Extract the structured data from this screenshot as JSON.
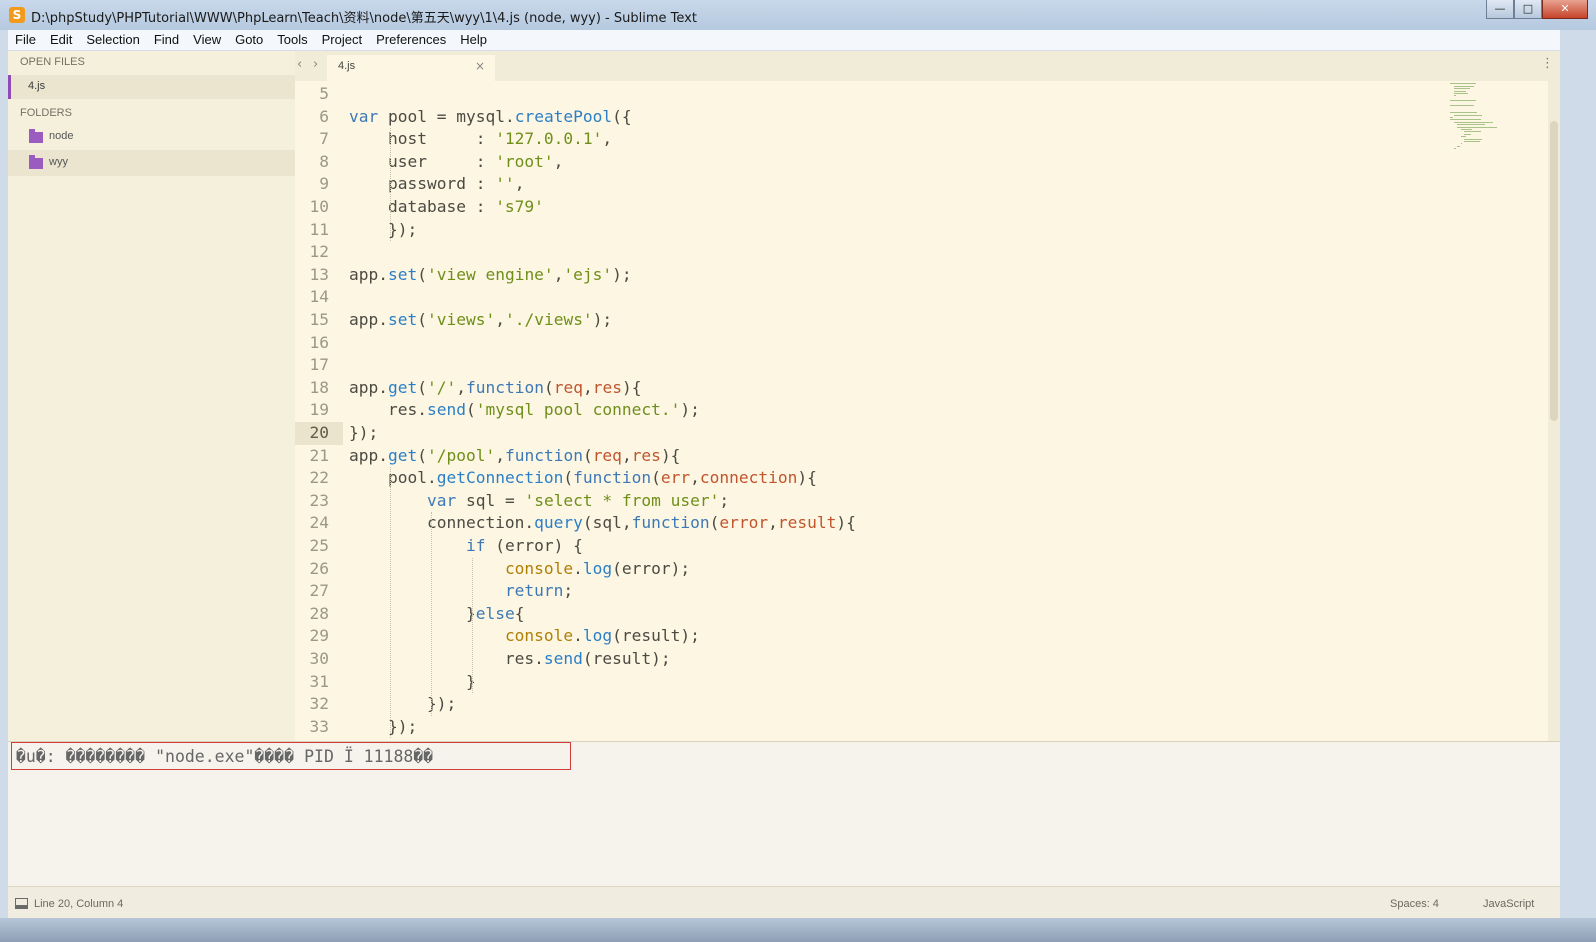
{
  "window": {
    "title": "D:\\phpStudy\\PHPTutorial\\WWW\\PhpLearn\\Teach\\资料\\node\\第五天\\wyy\\1\\4.js (node, wyy) - Sublime Text",
    "app_icon_glyph": "S",
    "minimize_glyph": "—",
    "maximize_glyph": "□",
    "close_glyph": "✕"
  },
  "menu": [
    "File",
    "Edit",
    "Selection",
    "Find",
    "View",
    "Goto",
    "Tools",
    "Project",
    "Preferences",
    "Help"
  ],
  "sidebar": {
    "open_files_heading": "OPEN FILES",
    "open_files": [
      "4.js"
    ],
    "folders_heading": "FOLDERS",
    "folders": [
      {
        "label": "node",
        "selected": false
      },
      {
        "label": "wyy",
        "selected": true
      }
    ]
  },
  "tabs": {
    "back_glyph": "‹",
    "forward_glyph": "›",
    "active_tab": "4.js",
    "close_glyph": "×",
    "overflow_glyph": "⋮"
  },
  "editor": {
    "current_line": "20",
    "line_numbers": [
      "5",
      "6",
      "7",
      "8",
      "9",
      "10",
      "11",
      "12",
      "13",
      "14",
      "15",
      "16",
      "17",
      "18",
      "19",
      "20",
      "21",
      "22",
      "23",
      "24",
      "25",
      "26",
      "27",
      "28",
      "29",
      "30",
      "31",
      "32",
      "33"
    ],
    "code": [
      [],
      [
        [
          "kw",
          "var"
        ],
        [
          "pl",
          " pool = mysql."
        ],
        [
          "fn",
          "createPool"
        ],
        [
          "pl",
          "({"
        ]
      ],
      [
        [
          "pl",
          "    host     : "
        ],
        [
          "str",
          "'127.0.0.1'"
        ],
        [
          "pl",
          ","
        ]
      ],
      [
        [
          "pl",
          "    user     : "
        ],
        [
          "str",
          "'root'"
        ],
        [
          "pl",
          ","
        ]
      ],
      [
        [
          "pl",
          "    password : "
        ],
        [
          "str",
          "''"
        ],
        [
          "pl",
          ","
        ]
      ],
      [
        [
          "pl",
          "    database : "
        ],
        [
          "str",
          "'s79'"
        ]
      ],
      [
        [
          "pl",
          "    });"
        ]
      ],
      [],
      [
        [
          "pl",
          "app."
        ],
        [
          "fn",
          "set"
        ],
        [
          "pl",
          "("
        ],
        [
          "str",
          "'view engine'"
        ],
        [
          "pl",
          ","
        ],
        [
          "str",
          "'ejs'"
        ],
        [
          "pl",
          ");"
        ]
      ],
      [],
      [
        [
          "pl",
          "app."
        ],
        [
          "fn",
          "set"
        ],
        [
          "pl",
          "("
        ],
        [
          "str",
          "'views'"
        ],
        [
          "pl",
          ","
        ],
        [
          "str",
          "'./views'"
        ],
        [
          "pl",
          ");"
        ]
      ],
      [],
      [],
      [
        [
          "pl",
          "app."
        ],
        [
          "fn",
          "get"
        ],
        [
          "pl",
          "("
        ],
        [
          "str",
          "'/'"
        ],
        [
          "pl",
          ","
        ],
        [
          "kw",
          "function"
        ],
        [
          "pl",
          "("
        ],
        [
          "prm",
          "req"
        ],
        [
          "pl",
          ","
        ],
        [
          "prm",
          "res"
        ],
        [
          "pl",
          "){"
        ]
      ],
      [
        [
          "pl",
          "    res."
        ],
        [
          "fn",
          "send"
        ],
        [
          "pl",
          "("
        ],
        [
          "str",
          "'mysql pool connect.'"
        ],
        [
          "pl",
          ");"
        ]
      ],
      [
        [
          "pl",
          "});"
        ]
      ],
      [
        [
          "pl",
          "app."
        ],
        [
          "fn",
          "get"
        ],
        [
          "pl",
          "("
        ],
        [
          "str",
          "'/pool'"
        ],
        [
          "pl",
          ","
        ],
        [
          "kw",
          "function"
        ],
        [
          "pl",
          "("
        ],
        [
          "prm",
          "req"
        ],
        [
          "pl",
          ","
        ],
        [
          "prm",
          "res"
        ],
        [
          "pl",
          "){"
        ]
      ],
      [
        [
          "pl",
          "    pool."
        ],
        [
          "fn",
          "getConnection"
        ],
        [
          "pl",
          "("
        ],
        [
          "kw",
          "function"
        ],
        [
          "pl",
          "("
        ],
        [
          "prm",
          "err"
        ],
        [
          "pl",
          ","
        ],
        [
          "prm",
          "connection"
        ],
        [
          "pl",
          "){"
        ]
      ],
      [
        [
          "pl",
          "        "
        ],
        [
          "kw",
          "var"
        ],
        [
          "pl",
          " sql = "
        ],
        [
          "str",
          "'select * from user'"
        ],
        [
          "pl",
          ";"
        ]
      ],
      [
        [
          "pl",
          "        connection."
        ],
        [
          "fn",
          "query"
        ],
        [
          "pl",
          "(sql,"
        ],
        [
          "kw",
          "function"
        ],
        [
          "pl",
          "("
        ],
        [
          "prm",
          "error"
        ],
        [
          "pl",
          ","
        ],
        [
          "prm",
          "result"
        ],
        [
          "pl",
          "){"
        ]
      ],
      [
        [
          "pl",
          "            "
        ],
        [
          "kw",
          "if"
        ],
        [
          "pl",
          " (error) {"
        ]
      ],
      [
        [
          "pl",
          "                "
        ],
        [
          "con",
          "console"
        ],
        [
          "pl",
          "."
        ],
        [
          "fn",
          "log"
        ],
        [
          "pl",
          "(error);"
        ]
      ],
      [
        [
          "pl",
          "                "
        ],
        [
          "kw",
          "return"
        ],
        [
          "pl",
          ";"
        ]
      ],
      [
        [
          "pl",
          "            }"
        ],
        [
          "kw",
          "else"
        ],
        [
          "pl",
          "{"
        ]
      ],
      [
        [
          "pl",
          "                "
        ],
        [
          "con",
          "console"
        ],
        [
          "pl",
          "."
        ],
        [
          "fn",
          "log"
        ],
        [
          "pl",
          "(result);"
        ]
      ],
      [
        [
          "pl",
          "                res."
        ],
        [
          "fn",
          "send"
        ],
        [
          "pl",
          "(result);"
        ]
      ],
      [
        [
          "pl",
          "            }"
        ]
      ],
      [
        [
          "pl",
          "        });"
        ]
      ],
      [
        [
          "pl",
          "    });"
        ]
      ]
    ]
  },
  "console": {
    "output": "�u�: �������� \"node.exe\"���� PID Ï 11188��"
  },
  "status": {
    "position": "Line 20, Column 4",
    "indent": "Spaces: 4",
    "syntax": "JavaScript"
  },
  "colors": {
    "keyword": "#3e79b6",
    "string": "#6f8f1a",
    "function": "#2b7fc7",
    "parameter": "#c0552e",
    "console": "#b07f05",
    "editor_bg": "#fcf6e2",
    "sidebar_accent": "#8f4bb5",
    "highlight_box": "#d43b3b"
  }
}
